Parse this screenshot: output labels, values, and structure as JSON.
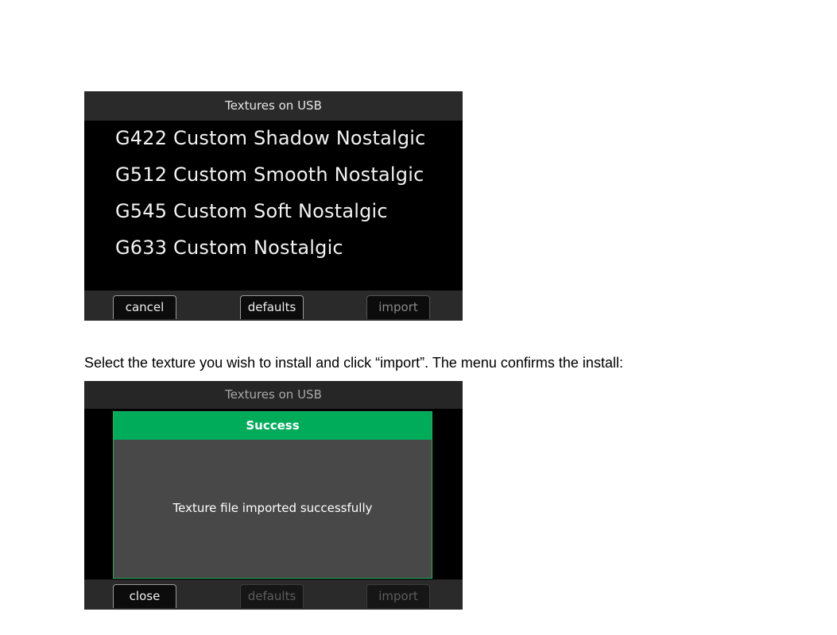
{
  "screen1": {
    "title": "Textures on USB",
    "textures": [
      "G422 Custom Shadow Nostalgic",
      "G512 Custom Smooth Nostalgic",
      "G545 Custom Soft Nostalgic",
      "G633 Custom Nostalgic"
    ],
    "buttons": {
      "cancel": "cancel",
      "defaults": "defaults",
      "import": "import"
    }
  },
  "instruction": "Select the texture you wish to install and click “import”. The menu confirms the install:",
  "screen2": {
    "title": "Textures on USB",
    "dialog": {
      "title": "Success",
      "message": "Texture file imported successfully"
    },
    "buttons": {
      "close": "close",
      "defaults": "defaults",
      "import": "import"
    }
  },
  "colors": {
    "success_header": "#00ac5a",
    "dialog_body": "#484848",
    "screen_bg": "#000000",
    "bar_bg": "#2a2a2a"
  }
}
